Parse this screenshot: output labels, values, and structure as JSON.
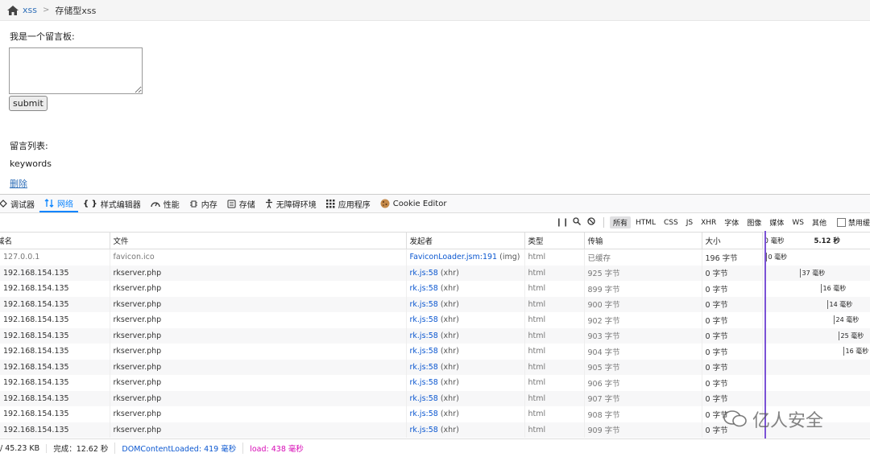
{
  "breadcrumb": {
    "root": "xss",
    "current": "存储型xss"
  },
  "board": {
    "label": "我是一个留言板:",
    "submit_label": "submit",
    "list_label": "留言列表:",
    "entry": "keywords",
    "delete_label": "删除"
  },
  "devtools": {
    "tabs": [
      {
        "label": "调试器",
        "icon": "debugger-icon"
      },
      {
        "label": "网络",
        "icon": "network-icon",
        "active": true
      },
      {
        "label": "样式编辑器",
        "icon": "style-editor-icon"
      },
      {
        "label": "性能",
        "icon": "performance-icon"
      },
      {
        "label": "内存",
        "icon": "memory-icon"
      },
      {
        "label": "存储",
        "icon": "storage-icon"
      },
      {
        "label": "无障碍环境",
        "icon": "accessibility-icon"
      },
      {
        "label": "应用程序",
        "icon": "application-icon"
      },
      {
        "label": "Cookie Editor",
        "icon": "cookie-icon"
      }
    ],
    "filters": [
      "所有",
      "HTML",
      "CSS",
      "JS",
      "XHR",
      "字体",
      "图像",
      "媒体",
      "WS",
      "其他"
    ],
    "disable_cache": "禁用缓",
    "columns": [
      "域名",
      "文件",
      "发起者",
      "类型",
      "传输",
      "大小"
    ],
    "timeline_labels": [
      "0 毫秒",
      "5.12 秒"
    ],
    "rows": [
      {
        "domain": "127.0.0.1",
        "file": "favicon.ico",
        "initiator": "FaviconLoader.jsm:191",
        "initiator_type": "(img)",
        "type": "html",
        "transfer": "已缓存",
        "size": "196 字节",
        "timing": "0 毫秒",
        "muted": true
      },
      {
        "domain": "192.168.154.135",
        "file": "rkserver.php",
        "initiator": "rk.js:58",
        "initiator_type": "(xhr)",
        "type": "html",
        "transfer": "925 字节",
        "size": "0 字节",
        "timing": "37 毫秒"
      },
      {
        "domain": "192.168.154.135",
        "file": "rkserver.php",
        "initiator": "rk.js:58",
        "initiator_type": "(xhr)",
        "type": "html",
        "transfer": "899 字节",
        "size": "0 字节",
        "timing": "16 毫秒"
      },
      {
        "domain": "192.168.154.135",
        "file": "rkserver.php",
        "initiator": "rk.js:58",
        "initiator_type": "(xhr)",
        "type": "html",
        "transfer": "900 字节",
        "size": "0 字节",
        "timing": "14 毫秒"
      },
      {
        "domain": "192.168.154.135",
        "file": "rkserver.php",
        "initiator": "rk.js:58",
        "initiator_type": "(xhr)",
        "type": "html",
        "transfer": "902 字节",
        "size": "0 字节",
        "timing": "24 毫秒"
      },
      {
        "domain": "192.168.154.135",
        "file": "rkserver.php",
        "initiator": "rk.js:58",
        "initiator_type": "(xhr)",
        "type": "html",
        "transfer": "903 字节",
        "size": "0 字节",
        "timing": "25 毫秒"
      },
      {
        "domain": "192.168.154.135",
        "file": "rkserver.php",
        "initiator": "rk.js:58",
        "initiator_type": "(xhr)",
        "type": "html",
        "transfer": "904 字节",
        "size": "0 字节",
        "timing": "16 毫秒"
      },
      {
        "domain": "192.168.154.135",
        "file": "rkserver.php",
        "initiator": "rk.js:58",
        "initiator_type": "(xhr)",
        "type": "html",
        "transfer": "905 字节",
        "size": "0 字节",
        "timing": ""
      },
      {
        "domain": "192.168.154.135",
        "file": "rkserver.php",
        "initiator": "rk.js:58",
        "initiator_type": "(xhr)",
        "type": "html",
        "transfer": "906 字节",
        "size": "0 字节",
        "timing": ""
      },
      {
        "domain": "192.168.154.135",
        "file": "rkserver.php",
        "initiator": "rk.js:58",
        "initiator_type": "(xhr)",
        "type": "html",
        "transfer": "907 字节",
        "size": "0 字节",
        "timing": ""
      },
      {
        "domain": "192.168.154.135",
        "file": "rkserver.php",
        "initiator": "rk.js:58",
        "initiator_type": "(xhr)",
        "type": "html",
        "transfer": "908 字节",
        "size": "0 字节",
        "timing": ""
      },
      {
        "domain": "192.168.154.135",
        "file": "rkserver.php",
        "initiator": "rk.js:58",
        "initiator_type": "(xhr)",
        "type": "html",
        "transfer": "909 字节",
        "size": "0 字节",
        "timing": ""
      }
    ],
    "status": {
      "transferred": "/ 45.23 KB",
      "finish": "完成：12.62 秒",
      "dcl": "DOMContentLoaded: 419 毫秒",
      "load": "load: 438 毫秒"
    }
  },
  "watermark": "亿人安全"
}
